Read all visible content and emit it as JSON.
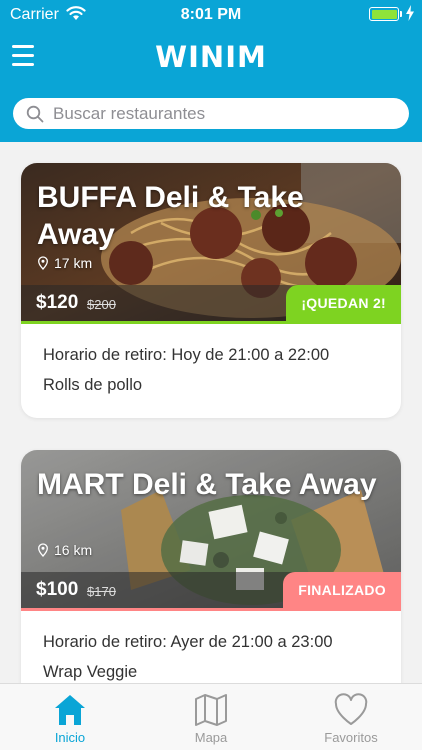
{
  "status_bar": {
    "carrier": "Carrier",
    "time": "8:01 PM"
  },
  "header": {
    "brand": "WINIM"
  },
  "search": {
    "placeholder": "Buscar restaurantes"
  },
  "colors": {
    "primary": "#0aa5d6",
    "available": "#7ed321",
    "ended": "#ff8585",
    "inactive": "#9a9a9a"
  },
  "cards": [
    {
      "title": "BUFFA Deli & Take Away",
      "distance": "17 km",
      "price": "$120",
      "old_price": "$200",
      "badge": "¡QUEDAN 2!",
      "pickup": "Horario de retiro: Hoy de 21:00 a 22:00",
      "item": "Rolls de pollo"
    },
    {
      "title": "MART Deli & Take Away",
      "distance": "16 km",
      "price": "$100",
      "old_price": "$170",
      "badge": "FINALIZADO",
      "pickup": "Horario de retiro: Ayer de 21:00 a 23:00",
      "item": "Wrap Veggie"
    }
  ],
  "tabs": [
    {
      "label": "Inicio",
      "icon": "home-icon",
      "active": true
    },
    {
      "label": "Mapa",
      "icon": "map-icon",
      "active": false
    },
    {
      "label": "Favoritos",
      "icon": "heart-icon",
      "active": false
    }
  ]
}
